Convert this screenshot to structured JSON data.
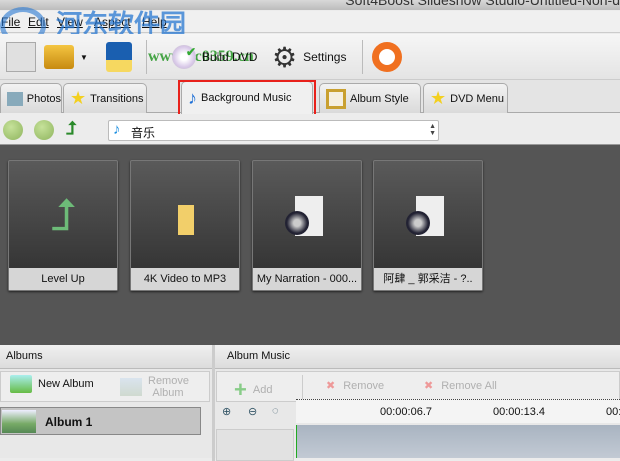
{
  "window": {
    "title": "Soft4Boost Slideshow Studio-Untitled-Non-d"
  },
  "watermark": {
    "text": "河东软件园",
    "url": "www.pc0359.cn"
  },
  "menu": [
    "File",
    "Edit",
    "View",
    "Aspect",
    "Help"
  ],
  "toolbar": {
    "build_dvd": "Build DVD",
    "settings": "Settings"
  },
  "tabs": [
    "Photos",
    "Transitions",
    "Background Music",
    "Album Style",
    "DVD Menu"
  ],
  "active_tab": "Background Music",
  "nav": {
    "path": "音乐"
  },
  "files": [
    {
      "label": "Level Up",
      "icon": "level-up-icon"
    },
    {
      "label": "4K Video to MP3",
      "icon": "folder-icon"
    },
    {
      "label": "My Narration - 000...",
      "icon": "audio-file-icon"
    },
    {
      "label": "阿肆 _ 郭采洁 - ?..",
      "icon": "audio-file-icon"
    }
  ],
  "albums": {
    "header": "Albums",
    "new_album": "New Album",
    "remove_album": "Remove Album",
    "items": [
      {
        "name": "Album 1"
      }
    ]
  },
  "album_music": {
    "header": "Album Music",
    "add": "Add",
    "remove": "Remove",
    "remove_all": "Remove All",
    "timeline": [
      "00:00:06.7",
      "00:00:13.4",
      "00:"
    ]
  }
}
